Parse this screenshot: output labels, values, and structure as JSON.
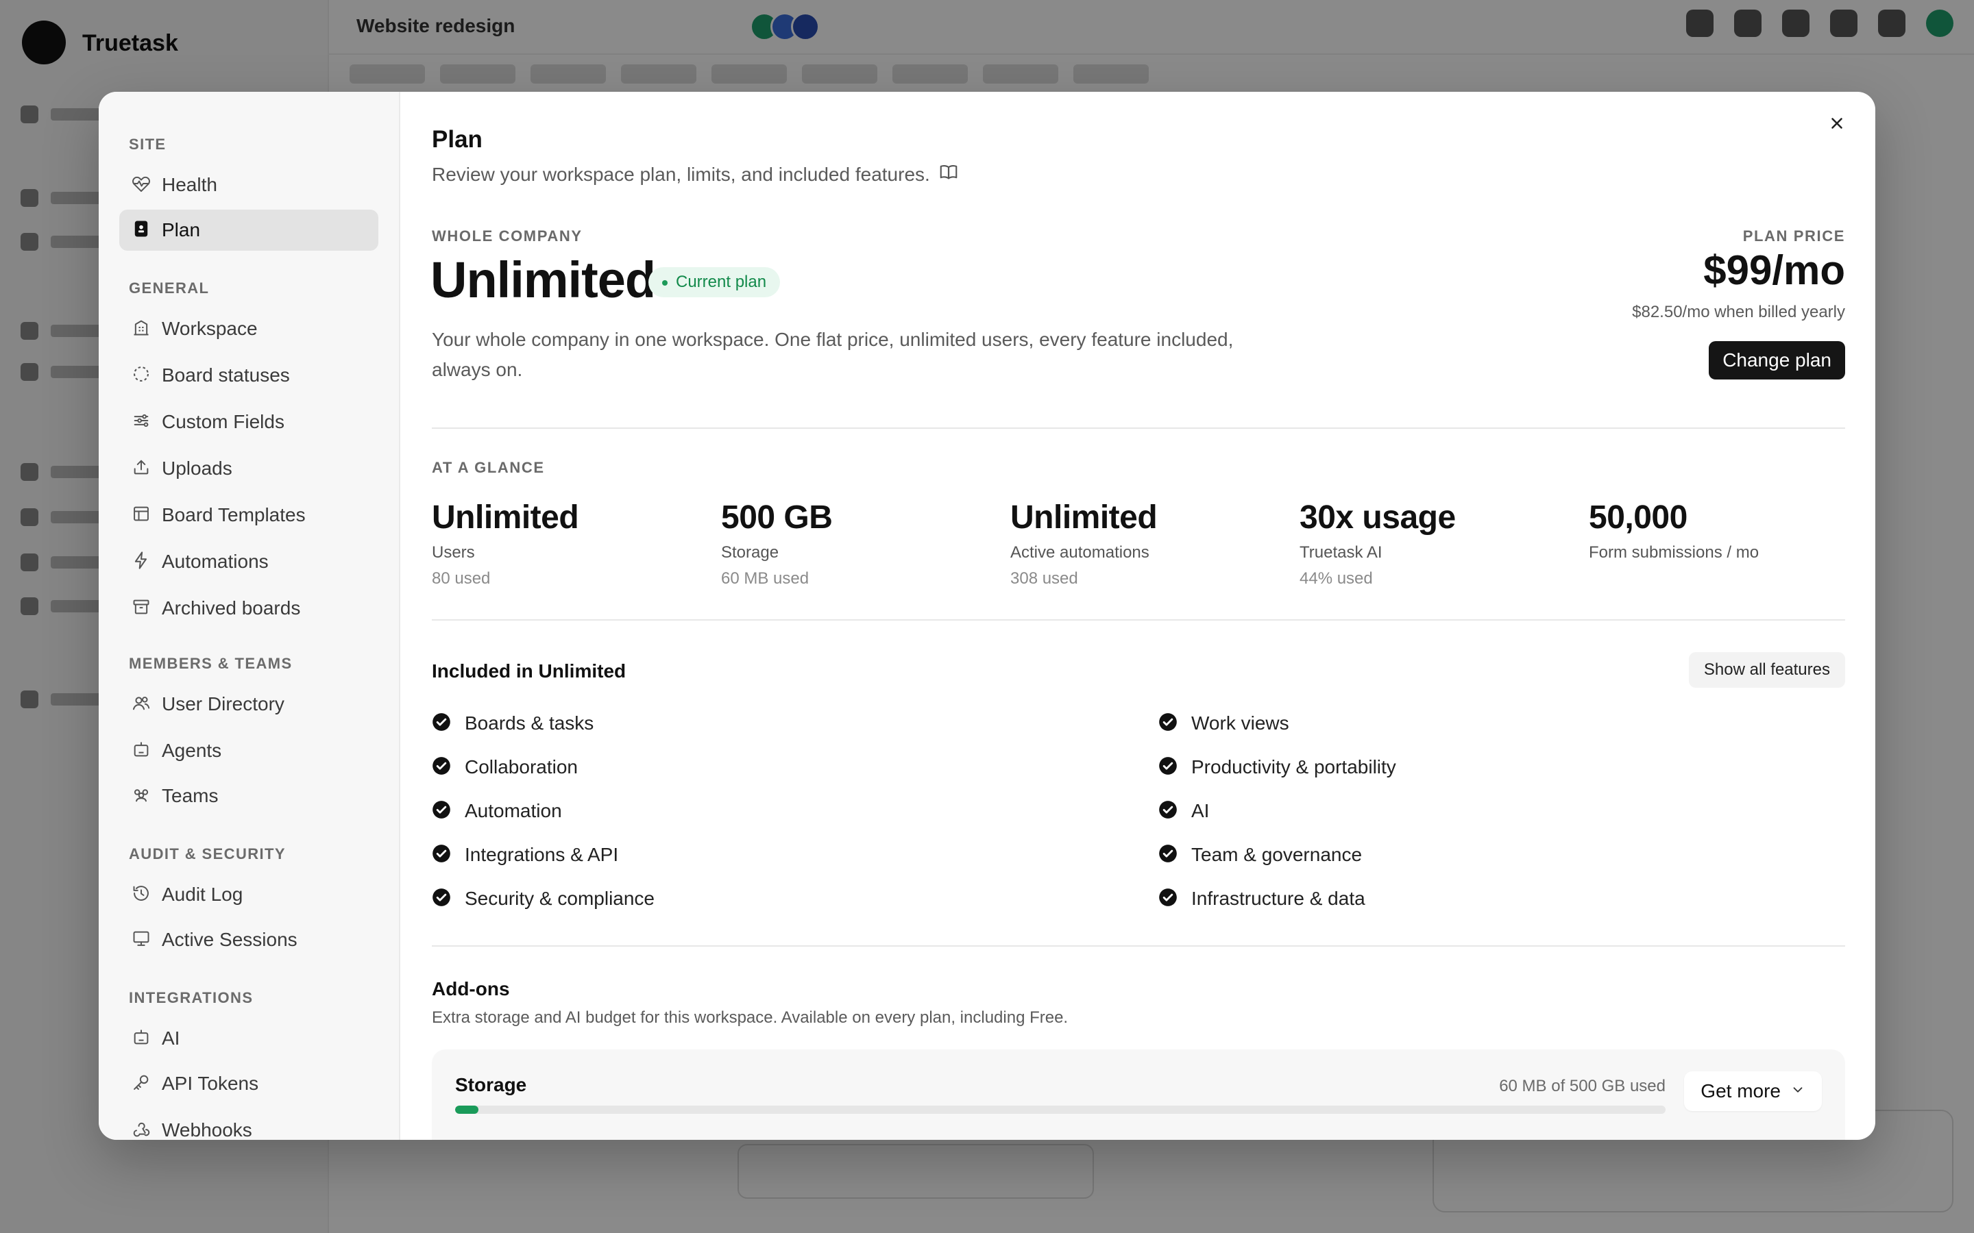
{
  "background_app": {
    "brand": "Truetask",
    "project": "Website redesign"
  },
  "sidebar": {
    "sections": [
      {
        "title": "SITE",
        "items": [
          {
            "label": "Health",
            "icon": "heart-pulse-icon"
          },
          {
            "label": "Plan",
            "icon": "plan-badge-icon",
            "active": true
          }
        ]
      },
      {
        "title": "GENERAL",
        "items": [
          {
            "label": "Workspace",
            "icon": "building-icon"
          },
          {
            "label": "Board statuses",
            "icon": "dashed-circle-icon"
          },
          {
            "label": "Custom Fields",
            "icon": "sliders-icon"
          },
          {
            "label": "Uploads",
            "icon": "upload-icon"
          },
          {
            "label": "Board Templates",
            "icon": "template-icon"
          },
          {
            "label": "Automations",
            "icon": "lightning-icon"
          },
          {
            "label": "Archived boards",
            "icon": "archive-icon"
          }
        ]
      },
      {
        "title": "MEMBERS & TEAMS",
        "items": [
          {
            "label": "User Directory",
            "icon": "users-icon"
          },
          {
            "label": "Agents",
            "icon": "robot-icon"
          },
          {
            "label": "Teams",
            "icon": "team-icon"
          }
        ]
      },
      {
        "title": "AUDIT & SECURITY",
        "items": [
          {
            "label": "Audit Log",
            "icon": "history-icon"
          },
          {
            "label": "Active Sessions",
            "icon": "monitor-icon"
          }
        ]
      },
      {
        "title": "INTEGRATIONS",
        "items": [
          {
            "label": "AI",
            "icon": "robot-icon"
          },
          {
            "label": "API Tokens",
            "icon": "key-icon"
          },
          {
            "label": "Webhooks",
            "icon": "webhook-icon"
          }
        ]
      }
    ]
  },
  "header": {
    "title": "Plan",
    "subtitle": "Review your workspace plan, limits, and included features.",
    "docs_icon": "book-icon",
    "close_icon": "close-icon"
  },
  "plan": {
    "kicker": "WHOLE COMPANY",
    "name": "Unlimited",
    "badge": "Current plan",
    "description": "Your whole company in one workspace. One flat price, unlimited users, every feature included, always on.",
    "price_kicker": "PLAN PRICE",
    "price": "$99/mo",
    "price_yearly": "$82.50/mo when billed yearly",
    "change_button": "Change plan",
    "accent_color": "#138a4b"
  },
  "glance": {
    "kicker": "AT A GLANCE",
    "stats": [
      {
        "value": "Unlimited",
        "name": "Users",
        "used": "80 used"
      },
      {
        "value": "500 GB",
        "name": "Storage",
        "used": "60 MB used"
      },
      {
        "value": "Unlimited",
        "name": "Active automations",
        "used": "308 used"
      },
      {
        "value": "30x usage",
        "name": "Truetask AI",
        "used": "44% used"
      },
      {
        "value": "50,000",
        "name": "Form submissions / mo",
        "used": ""
      }
    ]
  },
  "included": {
    "title": "Included in Unlimited",
    "show_all_button": "Show all features",
    "left": [
      "Boards & tasks",
      "Collaboration",
      "Automation",
      "Integrations & API",
      "Security & compliance"
    ],
    "right": [
      "Work views",
      "Productivity & portability",
      "AI",
      "Team & governance",
      "Infrastructure & data"
    ]
  },
  "addons": {
    "title": "Add-ons",
    "subtitle": "Extra storage and AI budget for this workspace. Available on every plan, including Free.",
    "items": [
      {
        "name": "Storage",
        "usage": "60 MB of 500 GB used",
        "fraction_used": 0.00012,
        "button": "Get more",
        "bar_color": "#1a9b5a"
      }
    ]
  }
}
